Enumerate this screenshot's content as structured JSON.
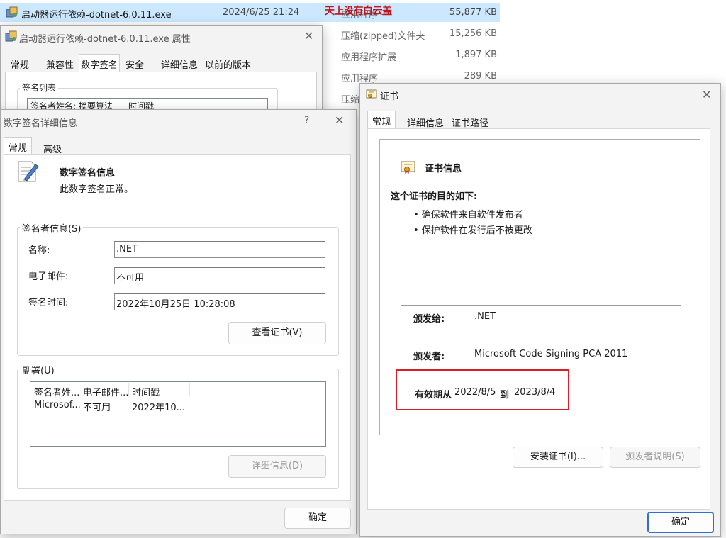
{
  "explorer": {
    "selected_file": {
      "name": "启动器运行依赖-dotnet-6.0.11.exe",
      "date": "2024/6/25 21:24",
      "type": "应用程序",
      "size": "55,877 KB"
    },
    "watermark": "天上没有白云盖",
    "rows": [
      {
        "type": "压缩(zipped)文件夹",
        "size": "15,256 KB"
      },
      {
        "type": "应用程序扩展",
        "size": "1,897 KB"
      },
      {
        "type": "应用程序",
        "size": "289 KB"
      },
      {
        "type": "压缩",
        "size": ""
      }
    ]
  },
  "props_window": {
    "title": "启动器运行依赖-dotnet-6.0.11.exe 属性",
    "tabs": [
      "常规",
      "兼容性",
      "数字签名",
      "安全",
      "详细信息",
      "以前的版本"
    ],
    "selected_tab": "数字签名",
    "sig_list_label": "签名列表",
    "sig_list_columns": [
      "签名者姓名:",
      "摘要算法",
      "时间戳"
    ]
  },
  "sig_details": {
    "title": "数字签名详细信息",
    "help_label": "?",
    "tabs": [
      "常规",
      "高级"
    ],
    "info_title": "数字签名信息",
    "info_status": "此数字签名正常。",
    "signer_group": "签名者信息(S)",
    "fields": [
      {
        "label": "名称:",
        "value": ".NET"
      },
      {
        "label": "电子邮件:",
        "value": "不可用"
      },
      {
        "label": "签名时间:",
        "value": "2022年10月25日 10:28:08"
      }
    ],
    "view_cert_button": "查看证书(V)",
    "countersig_group": "副署(U)",
    "countersig_columns": [
      "签名者姓...",
      "电子邮件...",
      "时间戳"
    ],
    "countersig_row": [
      "Microsof...",
      "不可用",
      "2022年10..."
    ],
    "details_button": "详细信息(D)",
    "ok_button": "确定"
  },
  "cert_window": {
    "title": "证书",
    "tabs": [
      "常规",
      "详细信息",
      "证书路径"
    ],
    "info_title": "证书信息",
    "purpose_heading": "这个证书的目的如下:",
    "purposes": [
      "• 确保软件来自软件发布者",
      "• 保护软件在发行后不被更改"
    ],
    "issued_to_label": "颁发给:",
    "issued_to": ".NET",
    "issued_by_label": "颁发者:",
    "issued_by": "Microsoft Code Signing PCA 2011",
    "valid_from_label": "有效期从",
    "valid_from": "2022/8/5",
    "valid_to_label": "到",
    "valid_to": "2023/8/4",
    "install_button": "安装证书(I)...",
    "issuer_stmt_button": "颁发者说明(S)",
    "ok_button": "确定",
    "highlight_color": "#d9202a"
  }
}
